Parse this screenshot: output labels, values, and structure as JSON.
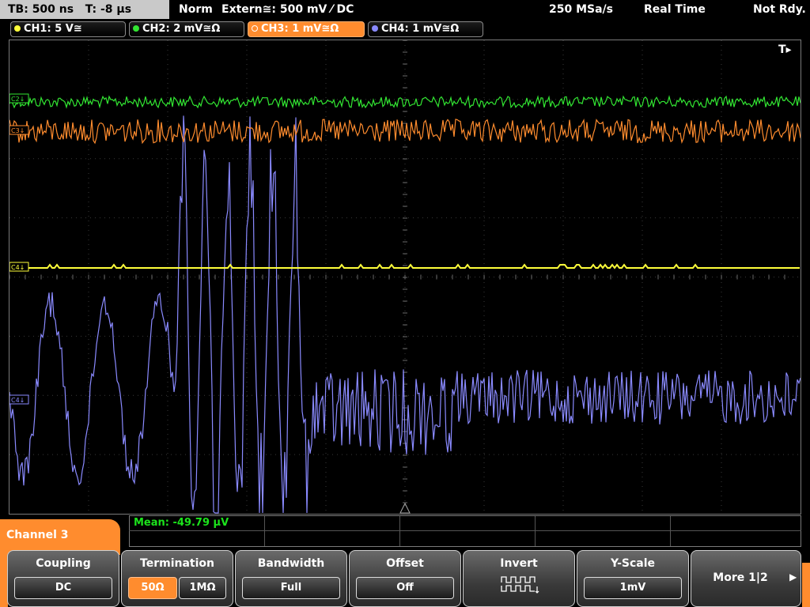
{
  "status": {
    "timebase": "TB: 500 ns",
    "trigger_time": "T: -8 µs",
    "trigger_mode": "Norm",
    "trigger_source": "Extern≅: 500 mV ⁄ DC",
    "sample_rate": "250 MSa/s",
    "acq_mode": "Real Time",
    "state": "Not Rdy."
  },
  "channels": [
    {
      "label": "CH1: 5 V≅",
      "color": "#ffff3a"
    },
    {
      "label": "CH2: 2 mV≅Ω",
      "color": "#32e632"
    },
    {
      "label": "CH3: 1 mV≅Ω",
      "color": "#ff8c2e",
      "active": true
    },
    {
      "label": "CH4: 1 mV≅Ω",
      "color": "#8a8aff"
    }
  ],
  "markers": {
    "trigger_flag": "T▸",
    "c1": "C4↓",
    "c2": "C2↓",
    "c3": "C3↓",
    "c4": "C4↓"
  },
  "measurement": {
    "label": "Mean: -49.79 µV"
  },
  "channel_menu": {
    "title": "Channel 3"
  },
  "softkeys": {
    "coupling": {
      "title": "Coupling",
      "value": "DC"
    },
    "termination": {
      "title": "Termination",
      "opt1": "50Ω",
      "opt2": "1MΩ"
    },
    "bandwidth": {
      "title": "Bandwidth",
      "value": "Full"
    },
    "offset": {
      "title": "Offset",
      "value": "Off"
    },
    "invert": {
      "title": "Invert"
    },
    "yscale": {
      "title": "Y-Scale",
      "value": "1mV"
    },
    "more": {
      "label": "More 1|2"
    }
  }
}
